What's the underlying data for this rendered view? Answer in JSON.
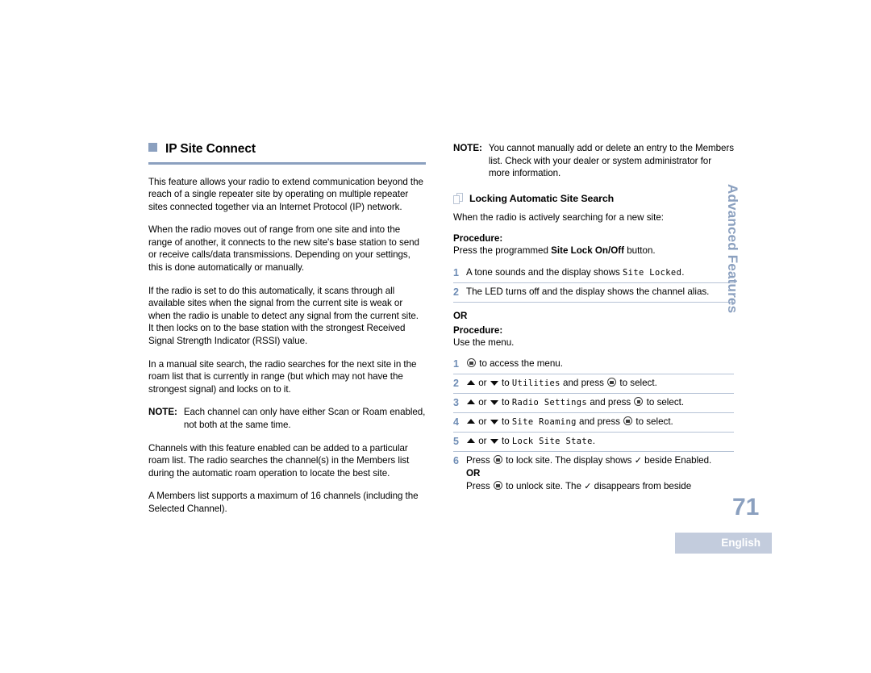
{
  "document": {
    "page_number": "71",
    "language_tab": "English",
    "vertical_tab": "Advanced Features",
    "accent_color": "#8ba0bf",
    "rule_color": "#b6c3d6",
    "step_number_color": "#6f8db5",
    "lang_tab_bg": "#c3ccdd"
  },
  "left_column": {
    "heading": "IP Site Connect",
    "bullet_icon": "square-bullet-icon",
    "paragraphs": [
      "This feature allows your radio to extend communication beyond the reach of a single repeater site by operating on multiple repeater sites connected together via an Internet Protocol (IP) network.",
      "When the radio moves out of range from one site and into the range of another, it connects to the new site's base station to send or receive calls/data transmissions. Depending on your settings, this is done automatically or manually.",
      "If the radio is set to do this automatically, it scans through all available sites when the signal from the current site is weak or when the radio is unable to detect any signal from the current site. It then locks on to the base station with the strongest Received Signal Strength Indicator (RSSI) value.",
      "In a manual site search, the radio searches for the next site in the roam list that is currently in range (but which may not have the strongest signal) and locks on to it."
    ],
    "note": {
      "label": "NOTE:",
      "text": "Each channel can only have either Scan or Roam enabled, not both at the same time."
    },
    "paragraphs_after_note": [
      "Channels with this feature enabled can be added to a particular roam list. The radio searches the channel(s) in the Members list during the automatic roam operation to locate the best site.",
      "A Members list supports a maximum of 16 channels (including the Selected Channel)."
    ]
  },
  "right_column": {
    "note": {
      "label": "NOTE:",
      "text": "You cannot manually add or delete an entry to the Members list. Check with your dealer or system administrator for more information."
    },
    "subsection": {
      "icon": "pages-icon",
      "title": "Locking Automatic Site Search",
      "lead": "When the radio is actively searching for a new site:"
    },
    "procedure_1": {
      "label": "Procedure:",
      "intro_prefix": "Press the programmed ",
      "intro_bold": "Site Lock On/Off",
      "intro_suffix": " button.",
      "steps": [
        {
          "num": "1",
          "prefix": "A tone sounds and the display shows ",
          "mono": "Site Locked",
          "suffix": "."
        },
        {
          "num": "2",
          "prefix": "The LED turns off and the display shows the channel alias.",
          "mono": "",
          "suffix": ""
        }
      ]
    },
    "or_separator": "OR",
    "procedure_2": {
      "label": "Procedure:",
      "intro": "Use the menu.",
      "steps": [
        {
          "num": "1",
          "text_after_icon": " to access the menu."
        },
        {
          "num": "2",
          "or_word": "or",
          "to_word": "to ",
          "mono": "Utilities",
          "mid": " and press ",
          "tail": " to select."
        },
        {
          "num": "3",
          "or_word": "or",
          "to_word": "to ",
          "mono": "Radio Settings",
          "mid": " and press ",
          "tail": " to select."
        },
        {
          "num": "4",
          "or_word": "or",
          "to_word": "to ",
          "mono": "Site Roaming",
          "mid": " and press ",
          "tail": " to select."
        },
        {
          "num": "5",
          "or_word": "or",
          "to_word": "to ",
          "mono": "Lock Site State",
          "mid": ".",
          "tail": ""
        },
        {
          "num": "6",
          "line1_prefix": "Press ",
          "line1_mid": " to lock site. The display shows ",
          "line1_check": "✓",
          "line1_suffix": " beside Enabled.",
          "or_label": "OR",
          "line2_prefix": "Press ",
          "line2_mid": " to unlock site. The ",
          "line2_check": "✓",
          "line2_suffix": " disappears from beside"
        }
      ]
    }
  }
}
